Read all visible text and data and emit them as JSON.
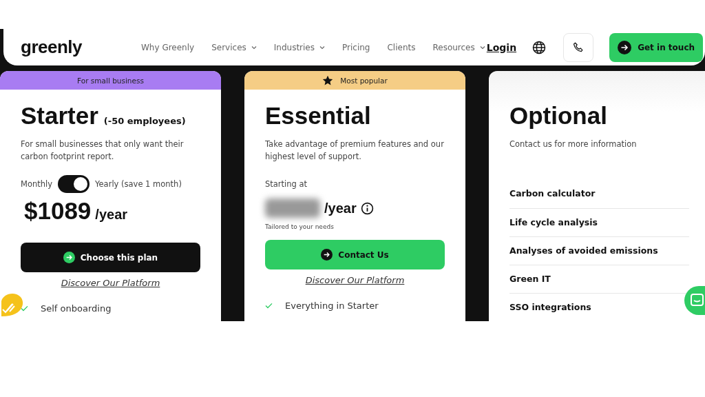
{
  "header": {
    "logo": "greenly",
    "nav": [
      {
        "label": "Why Greenly",
        "has_dropdown": false
      },
      {
        "label": "Services",
        "has_dropdown": true
      },
      {
        "label": "Industries",
        "has_dropdown": true
      },
      {
        "label": "Pricing",
        "has_dropdown": false
      },
      {
        "label": "Clients",
        "has_dropdown": false
      },
      {
        "label": "Resources",
        "has_dropdown": true
      }
    ],
    "login": "Login",
    "cta": "Get in touch"
  },
  "plans": [
    {
      "kind": "starter",
      "banner": "For small business",
      "color": "#a87cf2",
      "title": "Starter",
      "title_note": "(-50 employees)",
      "description": "For small businesses that only want their carbon footprint report.",
      "billing": {
        "left": "Monthly",
        "right": "Yearly (save 1 month)",
        "on": true
      },
      "price": "$1089",
      "period": "/year",
      "button": "Choose this plan",
      "link": "Discover Our Platform",
      "features": [
        "Self onboarding"
      ]
    },
    {
      "kind": "essential",
      "banner": "Most popular",
      "color": "#f5cd85",
      "title": "Essential",
      "description": "Take advantage of premium features and our highest level of support.",
      "starting": "Starting at",
      "period": "/year",
      "note": "Tailored to your needs",
      "button": "Contact Us",
      "link": "Discover Our Platform",
      "features": [
        "Everything in Starter"
      ]
    },
    {
      "kind": "optional",
      "title": "Optional",
      "description": "Contact us for more information",
      "options": [
        "Carbon calculator",
        "Life cycle analysis",
        "Analyses of avoided emissions",
        "Green IT",
        "SSO integrations"
      ]
    }
  ]
}
